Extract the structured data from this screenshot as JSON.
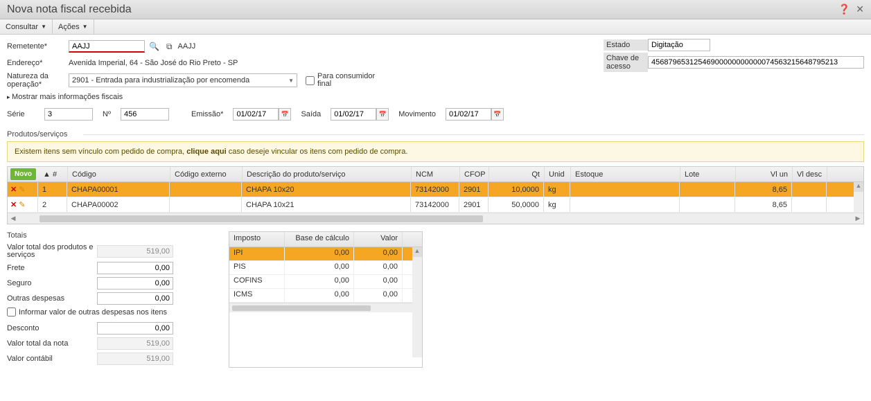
{
  "titlebar": {
    "title": "Nova nota fiscal recebida"
  },
  "menu": {
    "consultar": "Consultar",
    "acoes": "Ações"
  },
  "form": {
    "remetente_label": "Remetente*",
    "remetente_value": "AAJJ",
    "remetente_link_text": "AAJJ",
    "endereco_label": "Endereço*",
    "endereco_value": "Avenida Imperial, 64 - São José do Rio Preto - SP",
    "natureza_label": "Natureza da operação*",
    "natureza_value": "2901 - Entrada para industrialização por encomenda",
    "consumidor_label": "Para consumidor final",
    "expand_label": "Mostrar mais informações fiscais",
    "serie_label": "Série",
    "serie_value": "3",
    "numero_label": "Nº",
    "numero_value": "456",
    "emissao_label": "Emissão*",
    "emissao_value": "01/02/17",
    "saida_label": "Saída",
    "saida_value": "01/02/17",
    "movimento_label": "Movimento",
    "movimento_value": "01/02/17"
  },
  "right": {
    "estado_label": "Estado",
    "estado_value": "Digitação",
    "chave_label": "Chave de acesso",
    "chave_value": "45687965312546900000000000074563215648795213"
  },
  "section_products": "Produtos/serviços",
  "warn": {
    "pre": "Existem itens sem vínculo com pedido de compra, ",
    "link": "clique aqui",
    "post": " caso deseje vincular os itens com pedido de compra."
  },
  "grid": {
    "novo": "Novo",
    "headers": {
      "seq": "▲ #",
      "codigo": "Código",
      "cod_ext": "Código externo",
      "desc": "Descrição do produto/serviço",
      "ncm": "NCM",
      "cfop": "CFOP",
      "qt": "Qt",
      "unid": "Unid",
      "estoque": "Estoque",
      "lote": "Lote",
      "vlun": "Vl un",
      "vldesc": "Vl desc"
    },
    "rows": [
      {
        "seq": "1",
        "codigo": "CHAPA00001",
        "cod_ext": "",
        "desc": "CHAPA 10x20",
        "ncm": "73142000",
        "cfop": "2901",
        "qt": "10,0000",
        "unid": "kg",
        "estoque": "",
        "lote": "",
        "vlun": "8,65",
        "vldesc": ""
      },
      {
        "seq": "2",
        "codigo": "CHAPA00002",
        "cod_ext": "",
        "desc": "CHAPA 10x21",
        "ncm": "73142000",
        "cfop": "2901",
        "qt": "50,0000",
        "unid": "kg",
        "estoque": "",
        "lote": "",
        "vlun": "8,65",
        "vldesc": ""
      }
    ]
  },
  "totals": {
    "title": "Totais",
    "valor_total_label": "Valor total dos produtos e serviços",
    "valor_total": "519,00",
    "frete_label": "Frete",
    "frete": "0,00",
    "seguro_label": "Seguro",
    "seguro": "0,00",
    "outras_label": "Outras despesas",
    "outras": "0,00",
    "informar_chk": "Informar valor de outras despesas nos itens",
    "desconto_label": "Desconto",
    "desconto": "0,00",
    "valor_nota_label": "Valor total da nota",
    "valor_nota": "519,00",
    "valor_contabil_label": "Valor contábil",
    "valor_contabil": "519,00"
  },
  "tax": {
    "headers": {
      "imposto": "Imposto",
      "base": "Base de cálculo",
      "valor": "Valor"
    },
    "rows": [
      {
        "imposto": "IPI",
        "base": "0,00",
        "valor": "0,00"
      },
      {
        "imposto": "PIS",
        "base": "0,00",
        "valor": "0,00"
      },
      {
        "imposto": "COFINS",
        "base": "0,00",
        "valor": "0,00"
      },
      {
        "imposto": "ICMS",
        "base": "0,00",
        "valor": "0,00"
      }
    ]
  }
}
